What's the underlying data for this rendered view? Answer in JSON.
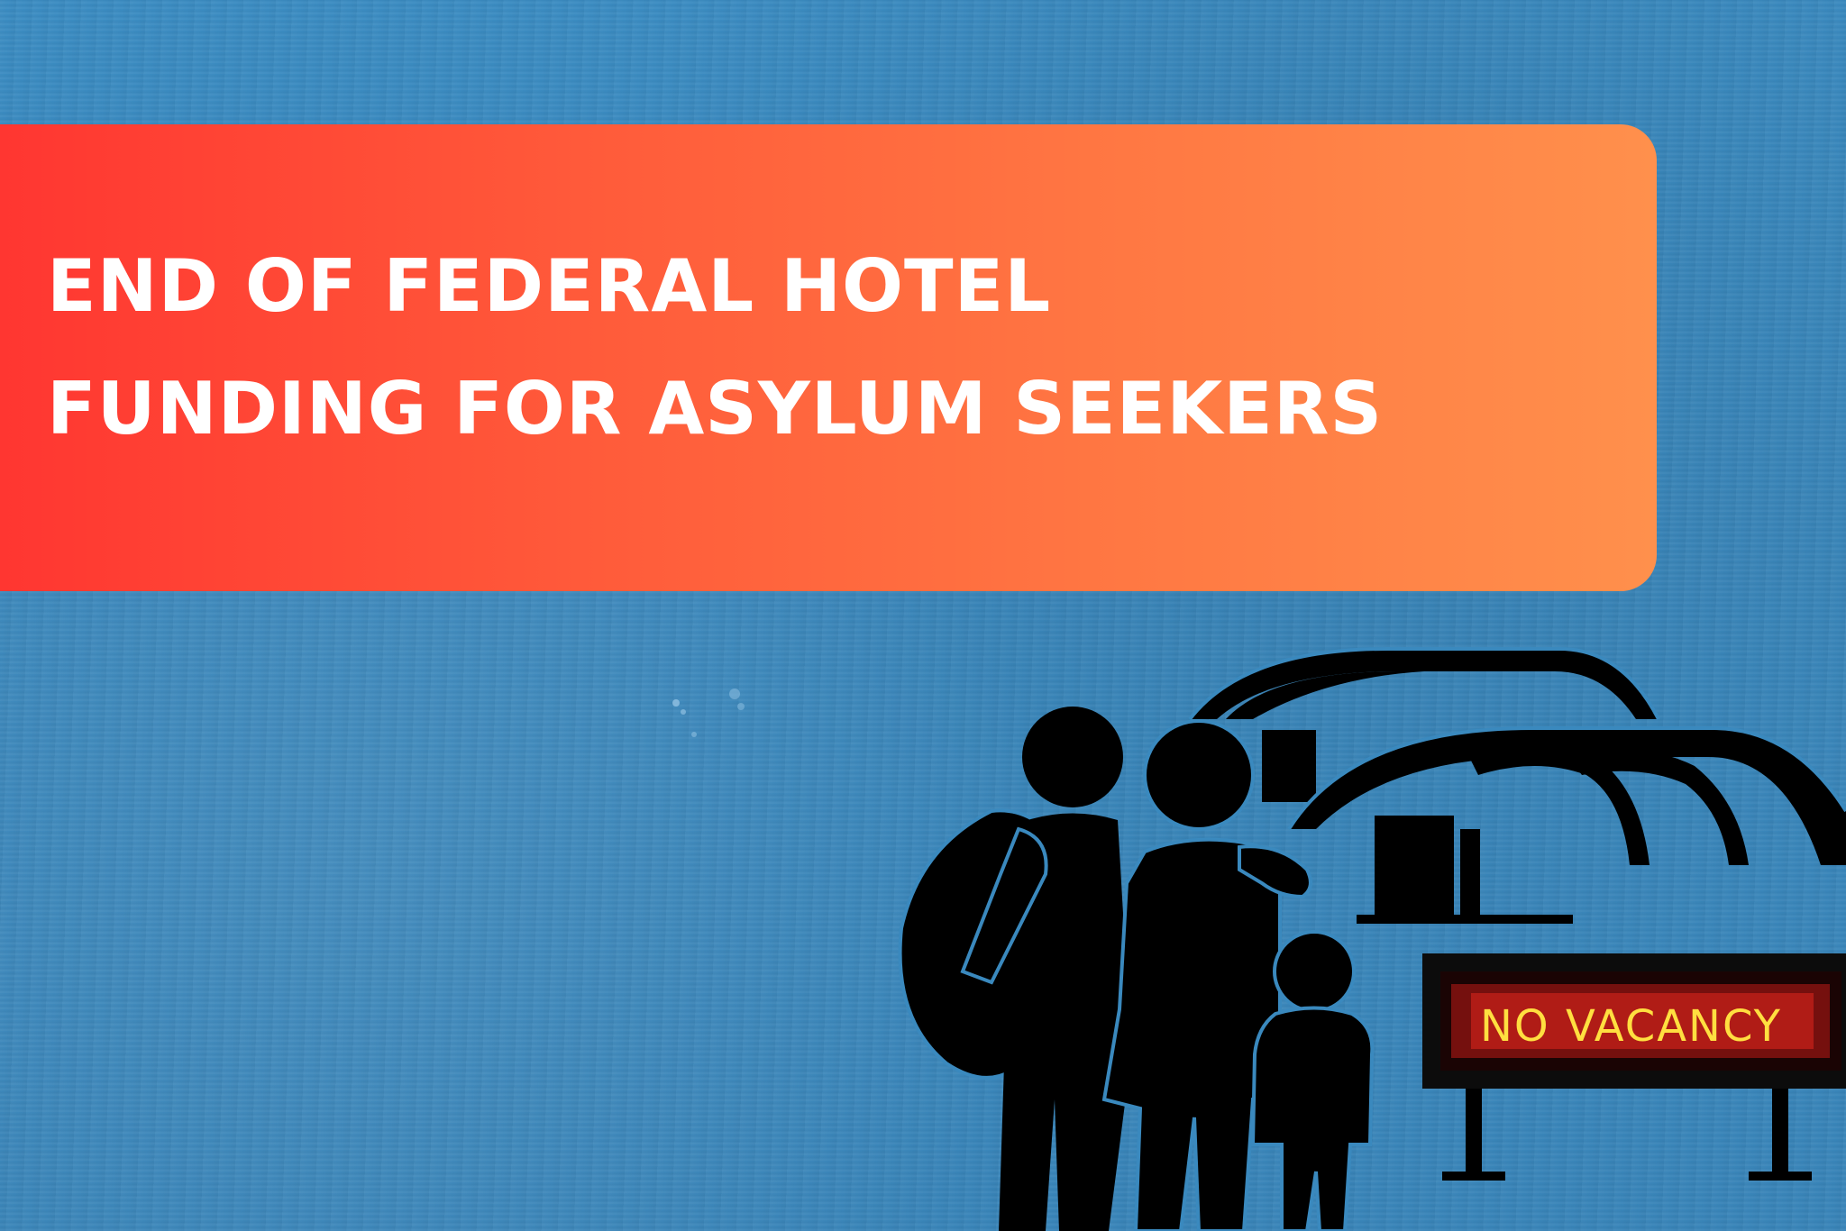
{
  "banner": {
    "title_line_1": "END OF FEDERAL HOTEL",
    "title_line_2": "FUNDING FOR ASYLUM SEEKERS",
    "gradient_start_color": "#ff3631",
    "gradient_end_color": "#ff904c"
  },
  "background": {
    "color": "#3a89be"
  },
  "illustration": {
    "sign_text": "NO VACANCY",
    "figures": [
      "adult-with-bag",
      "adult-holding-child",
      "child"
    ],
    "icons": [
      "family-icon",
      "hotel-shelter-icon",
      "neon-sign-icon"
    ]
  }
}
